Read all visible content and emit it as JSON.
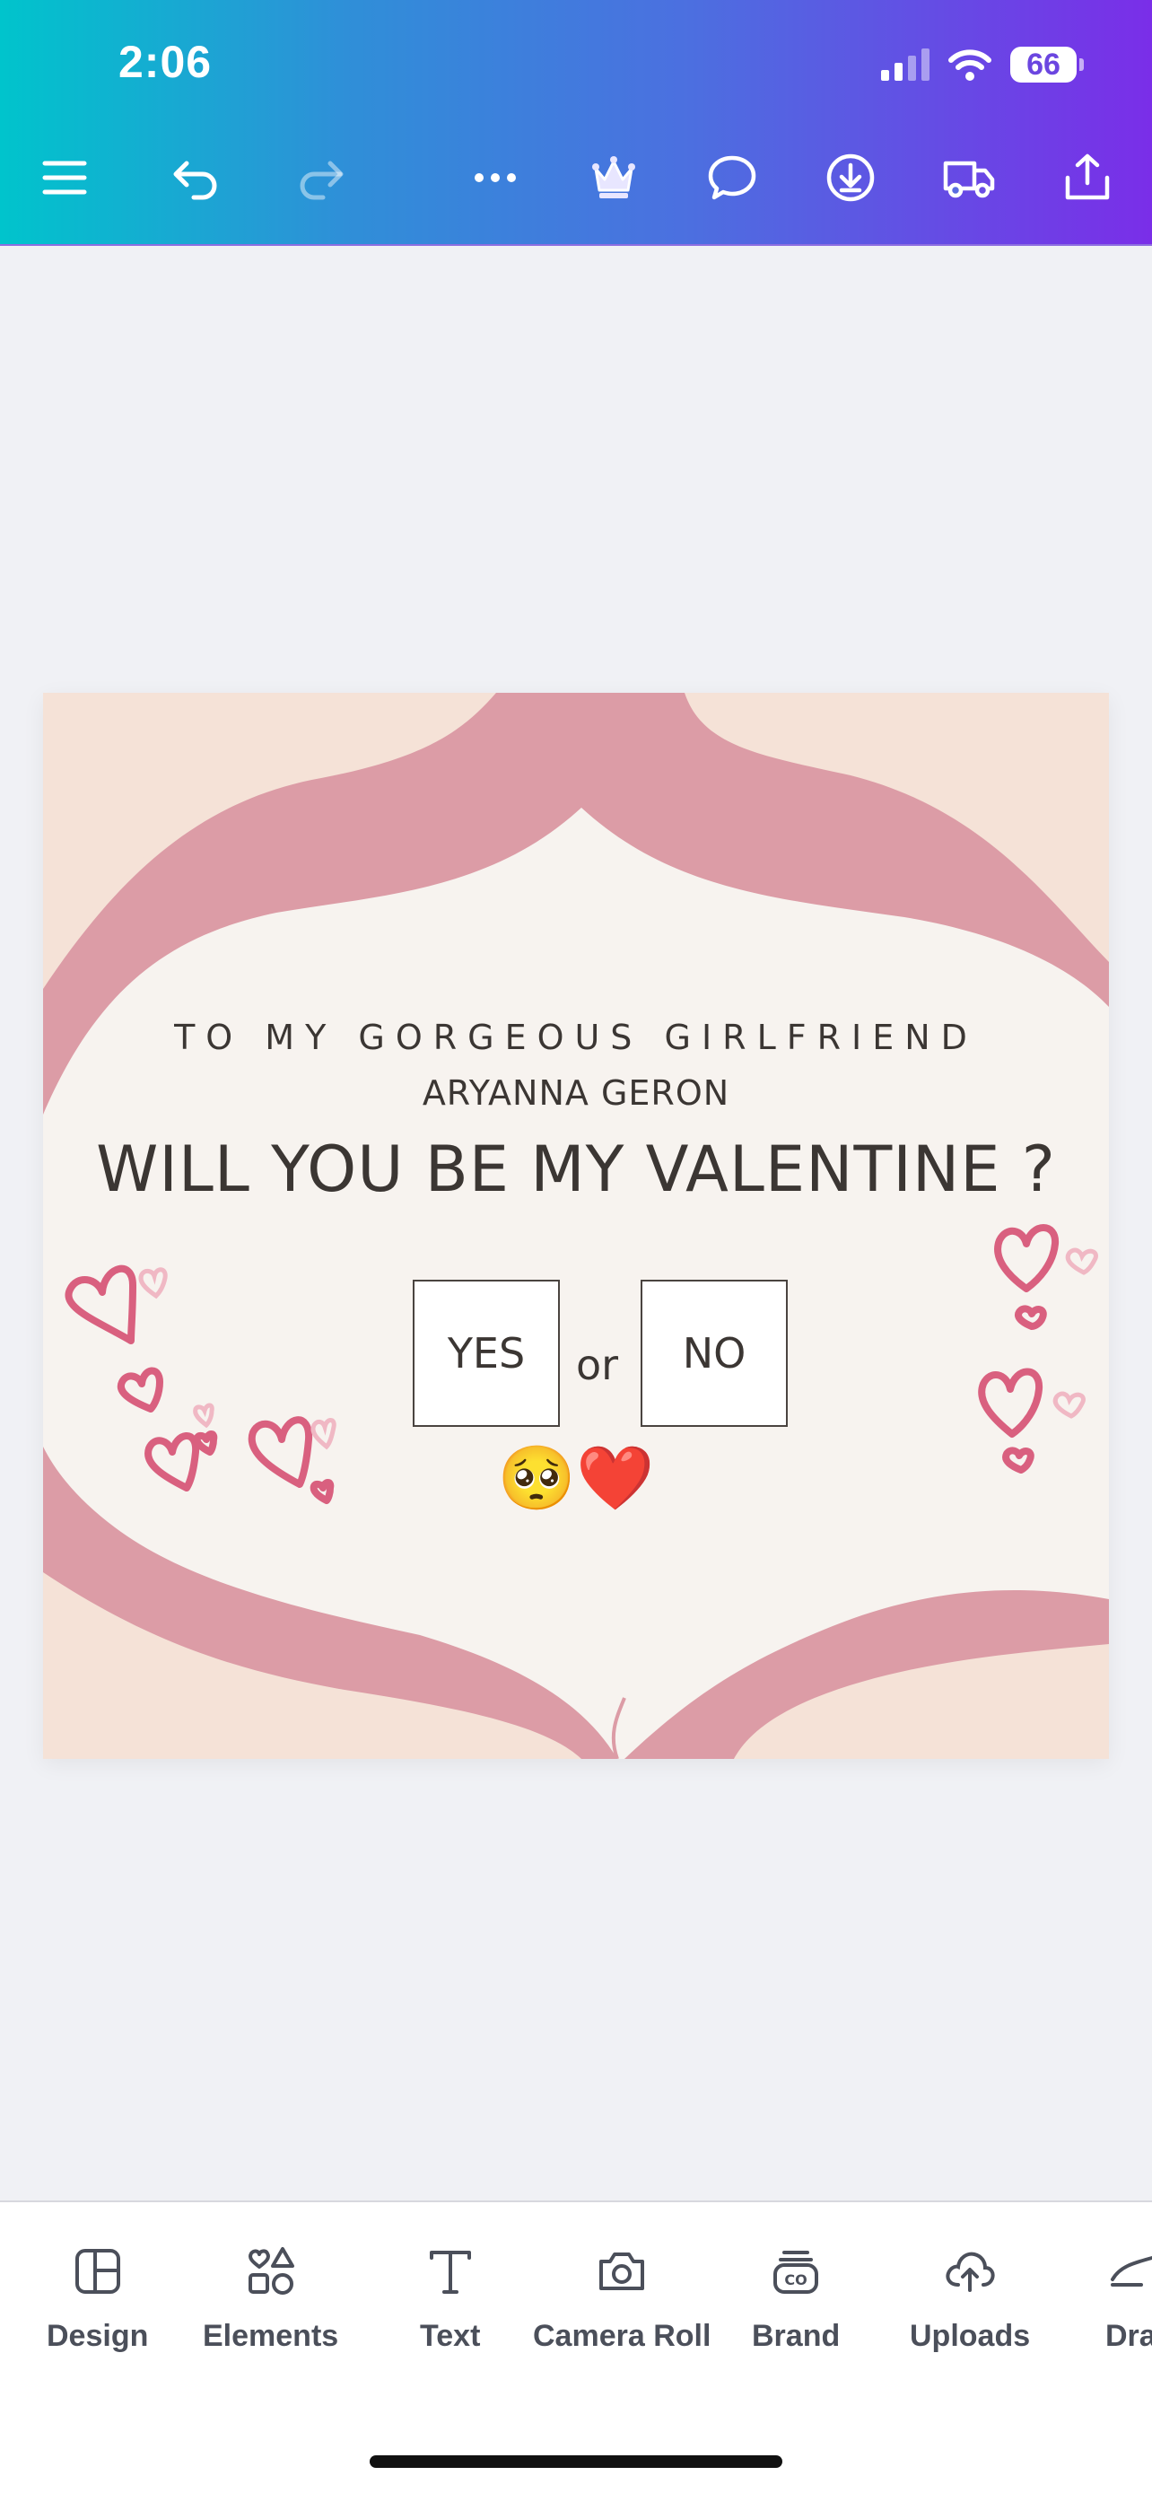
{
  "status_bar": {
    "time": "2:06",
    "battery": "66"
  },
  "toolbar": {
    "icons": [
      "menu-icon",
      "undo-icon",
      "redo-icon",
      "more-icon",
      "crown-icon",
      "comment-icon",
      "download-icon",
      "delivery-truck-icon",
      "share-icon"
    ]
  },
  "design": {
    "line1": "TO MY GORGEOUS GIRLFRIEND",
    "line2": "ARYANNA GERON",
    "line3": "WILL YOU BE MY VALENTINE ?",
    "yes_label": "YES",
    "or_label": "or",
    "no_label": "NO",
    "emojis": "🥺❤️",
    "colors": {
      "background": "#f5e2d7",
      "wave": "#dc9ca6",
      "panel": "#f7f3ef",
      "hearts": "#d9607f"
    }
  },
  "bottom_nav": {
    "design": "Design",
    "elements": "Elements",
    "text": "Text",
    "camera_roll": "Camera Roll",
    "brand": "Brand",
    "uploads": "Uploads",
    "draw": "Draw"
  },
  "colors": {
    "accent_gradient_start": "#00c4cc",
    "accent_gradient_end": "#7a2ee8"
  }
}
